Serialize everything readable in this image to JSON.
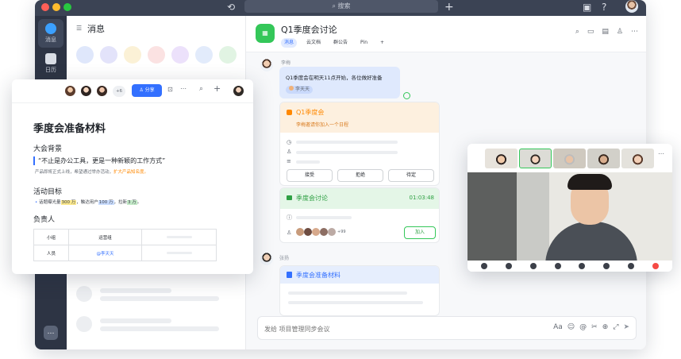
{
  "titlebar": {
    "search_placeholder": "搜索",
    "history_icon": "history-icon",
    "plus_icon": "plus-icon"
  },
  "rail": {
    "items": [
      {
        "label": "消息",
        "icon": "message-icon"
      },
      {
        "label": "日历",
        "icon": "calendar-icon"
      }
    ],
    "more_label": "…"
  },
  "messages_panel": {
    "title": "消息"
  },
  "chat": {
    "group_name": "Q1季度会讨论",
    "tabs": [
      {
        "label": "消息",
        "active": true
      },
      {
        "label": "云文档"
      },
      {
        "label": "群公告"
      },
      {
        "label": "Pin"
      },
      {
        "label": "+"
      }
    ],
    "message1": {
      "sender": "李梅",
      "text": "Q1季度会在明天11点开始，各位做好准备",
      "mention": "李天天"
    },
    "event_card": {
      "title": "Q1季度会",
      "subtitle": "李梅邀请你加入一个日程",
      "buttons": [
        "接受",
        "拒绝",
        "待定"
      ]
    },
    "meeting_card": {
      "title": "季度会讨论",
      "duration": "01:03:48",
      "attendee_count": "+99",
      "join_label": "加入"
    },
    "message2": {
      "sender": "张扬",
      "doc_title": "季度会准备材料"
    },
    "input_placeholder": "发给 项目管理同步会议",
    "input_tools": [
      "Aa",
      "☺",
      "@",
      "✂",
      "⊕",
      "⤢",
      "➤"
    ]
  },
  "doc": {
    "avatar_extra": "+6",
    "share_label": "分享",
    "title": "季度会准备材料",
    "section1_heading": "大会背景",
    "quote": "“不止是办公工具，更是一种新颖的工作方式”",
    "note_prefix": "产品即将正式上线，希望通过举办活动，",
    "note_highlight": "扩大产品知名度。",
    "section2_heading": "活动目标",
    "goal_prefix": "话题曝光量",
    "goal_v1": "300 万",
    "goal_mid1": "，触达用户",
    "goal_v2": "100 万",
    "goal_mid2": "，拉新",
    "goal_v3": "3 万",
    "goal_suffix": "。",
    "section3_heading": "负责人",
    "table": {
      "rows": [
        {
          "label": "小组",
          "value": "运营组"
        },
        {
          "label": "人员",
          "value": "@李天天"
        }
      ]
    }
  },
  "colors": {
    "accent": "#3370ff",
    "green": "#34c759",
    "orange": "#ff8800",
    "dark_rail": "#2d3444"
  }
}
